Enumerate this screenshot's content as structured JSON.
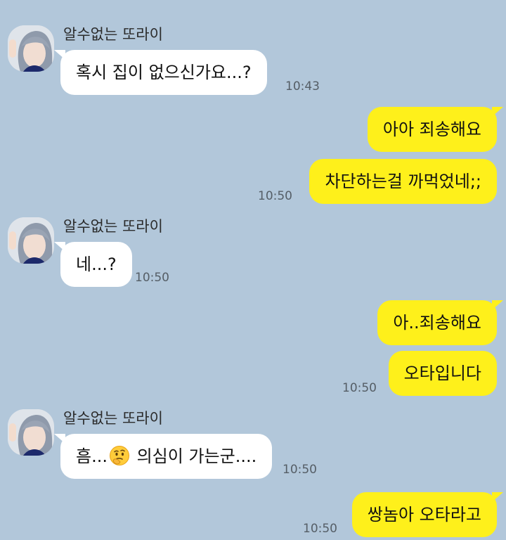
{
  "messages": [
    {
      "dir": "in",
      "sender": "알수없는 또라이",
      "text": "혹시 집이 없으신가요...?",
      "time": "10:43"
    },
    {
      "dir": "out",
      "text": "아아 죄송해요"
    },
    {
      "dir": "out",
      "text": "차단하는걸 까먹었네;;",
      "time": "10:50"
    },
    {
      "dir": "in",
      "sender": "알수없는 또라이",
      "text": "네...?",
      "time": "10:50"
    },
    {
      "dir": "out",
      "text": "아..죄송해요"
    },
    {
      "dir": "out",
      "text": "오타입니다",
      "time": "10:50"
    },
    {
      "dir": "in",
      "sender": "알수없는 또라이",
      "text_before": "흠...",
      "emoji": "thinking-face-icon",
      "text_after": " 의심이 가는군....",
      "time": "10:50"
    },
    {
      "dir": "out",
      "text": "쌍놈아 오타라고",
      "time": "10:50"
    }
  ],
  "colors": {
    "background": "#b2c7da",
    "incoming_bubble": "#ffffff",
    "outgoing_bubble": "#fef01b"
  }
}
